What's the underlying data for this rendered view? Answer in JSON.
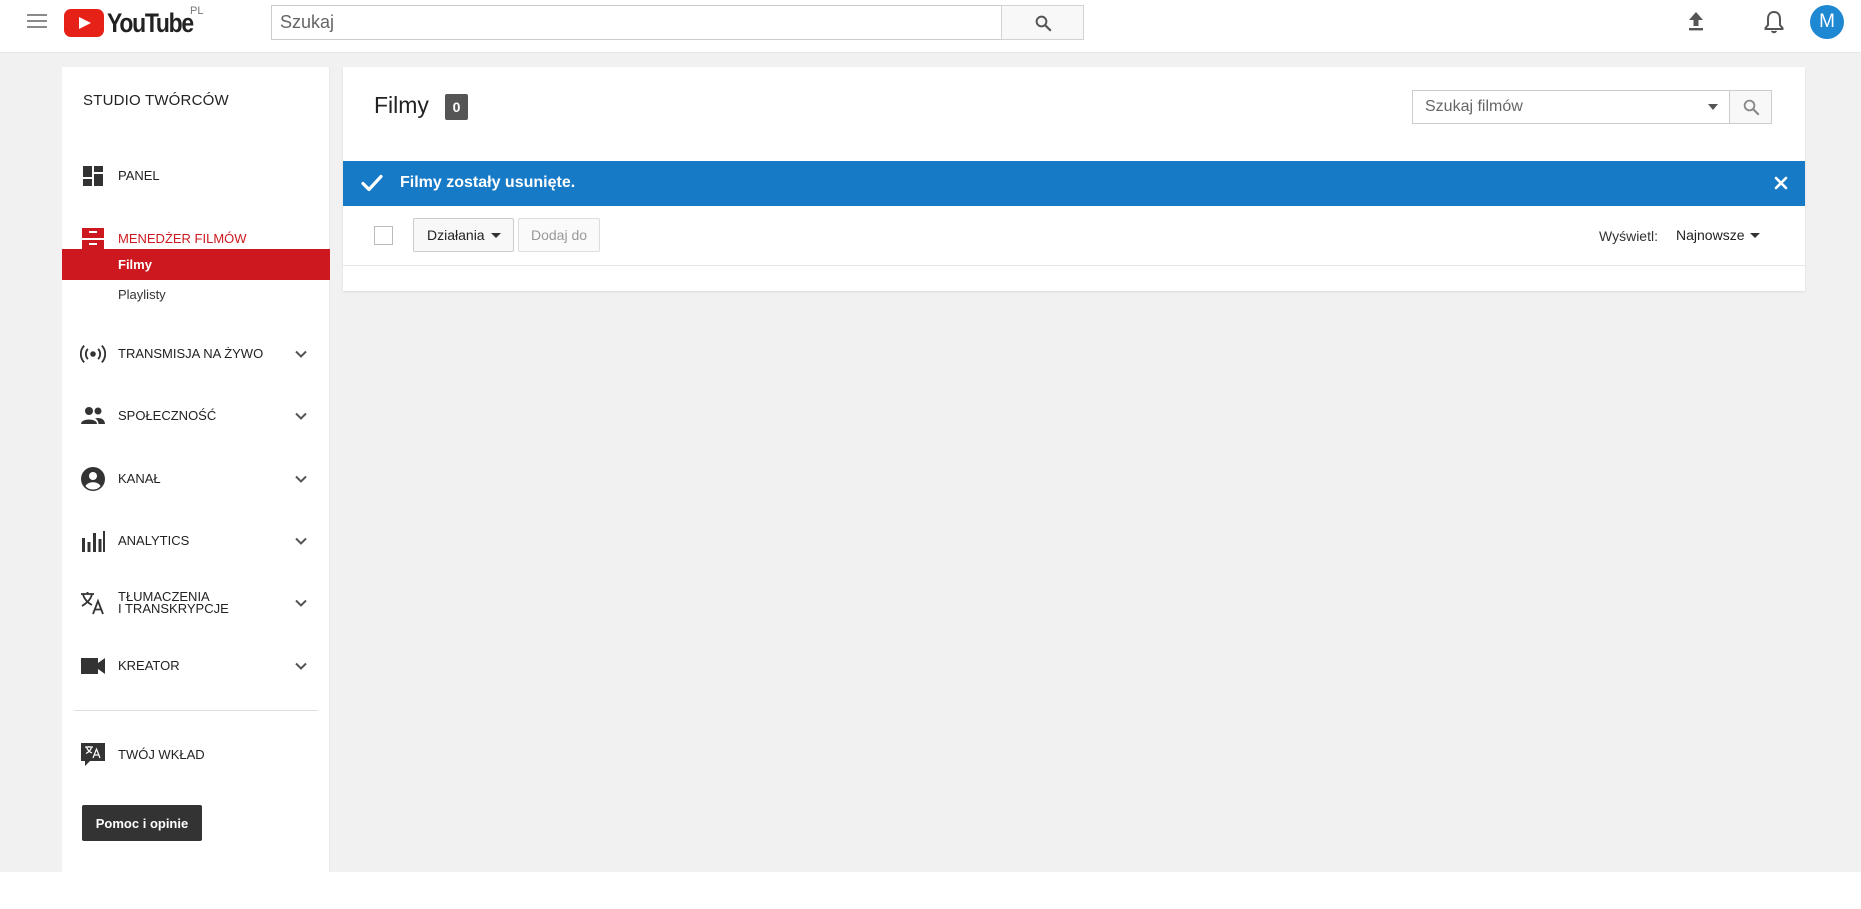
{
  "header": {
    "logo_text": "YouTube",
    "country": "PL",
    "search_placeholder": "Szukaj",
    "avatar_letter": "M",
    "icons": [
      "menu-icon",
      "search-icon",
      "upload-icon",
      "bell-icon"
    ]
  },
  "sidebar": {
    "title": "STUDIO TWÓRCÓW",
    "items": [
      {
        "label": "PANEL",
        "icon": "dashboard-icon"
      },
      {
        "label": "MENEDŻER FILMÓW",
        "icon": "video-manager-icon",
        "active": true
      },
      {
        "label": "TRANSMISJA NA ŻYWO",
        "icon": "live-broadcast-icon"
      },
      {
        "label": "SPOŁECZNOŚĆ",
        "icon": "community-icon"
      },
      {
        "label": "KANAŁ",
        "icon": "channel-icon"
      },
      {
        "label": "ANALYTICS",
        "icon": "analytics-icon"
      },
      {
        "label_line1": "TŁUMACZENIA",
        "label_line2": "I TRANSKRYPCJE",
        "icon": "translate-icon"
      },
      {
        "label": "KREATOR",
        "icon": "creator-camera-icon"
      },
      {
        "label": "TWÓJ WKŁAD",
        "icon": "contribution-icon"
      }
    ],
    "sub_items": [
      {
        "label": "Filmy",
        "selected": true
      },
      {
        "label": "Playlisty"
      }
    ],
    "help_button": "Pomoc i opinie",
    "active_color": "#cc181e"
  },
  "content": {
    "title": "Filmy",
    "count": "0",
    "search_placeholder": "Szukaj filmów",
    "notice_text": "Filmy zostały usunięte.",
    "notice_color": "#167ac6",
    "actions_label": "Działania",
    "add_to_label": "Dodaj do",
    "view_label": "Wyświetl:",
    "sort_value": "Najnowsze"
  }
}
